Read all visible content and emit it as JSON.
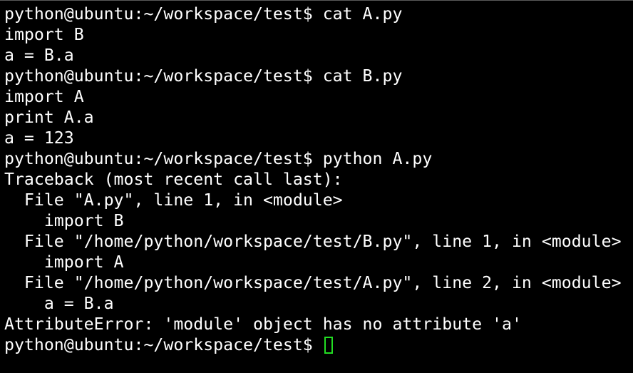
{
  "terminal": {
    "lines": [
      "python@ubuntu:~/workspace/test$ cat A.py",
      "import B",
      "a = B.a",
      "python@ubuntu:~/workspace/test$ cat B.py",
      "import A",
      "print A.a",
      "a = 123",
      "python@ubuntu:~/workspace/test$ python A.py",
      "Traceback (most recent call last):",
      "  File \"A.py\", line 1, in <module>",
      "    import B",
      "  File \"/home/python/workspace/test/B.py\", line 1, in <module>",
      "    import A",
      "  File \"/home/python/workspace/test/A.py\", line 2, in <module>",
      "    a = B.a",
      "AttributeError: 'module' object has no attribute 'a'"
    ],
    "prompt": "python@ubuntu:~/workspace/test$ ",
    "text_color": "#ffffff",
    "background_color": "#000000",
    "cursor_color": "#22dd22"
  }
}
